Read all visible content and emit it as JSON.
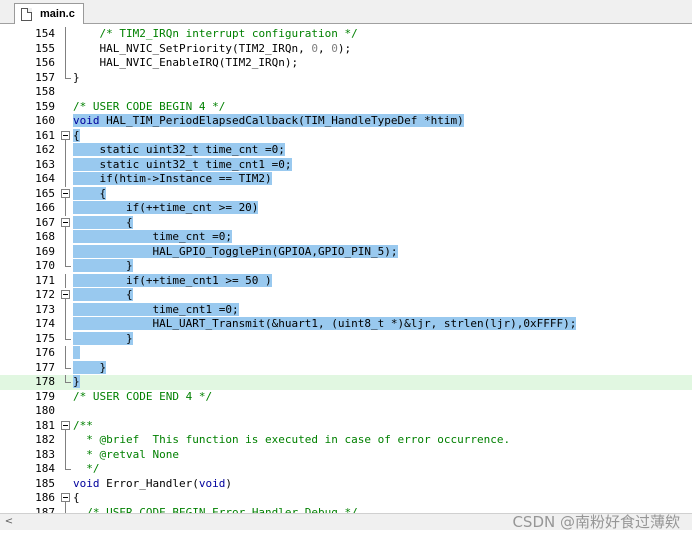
{
  "tab": {
    "label": "main.c",
    "icon": "file-icon"
  },
  "editor": {
    "current_line": "178",
    "lines": [
      {
        "n": "154",
        "fold": "line",
        "seg": [
          [
            "    ",
            ""
          ],
          [
            "/* TIM2_IRQn interrupt configuration */",
            "cm"
          ]
        ]
      },
      {
        "n": "155",
        "fold": "line",
        "seg": [
          [
            "    HAL_NVIC_SetPriority(TIM2_IRQn, ",
            ""
          ],
          [
            "0",
            "num"
          ],
          [
            ", ",
            ""
          ],
          [
            "0",
            "num"
          ],
          [
            ");",
            ""
          ]
        ]
      },
      {
        "n": "156",
        "fold": "line",
        "seg": [
          [
            "    HAL_NVIC_EnableIRQ(TIM2_IRQn);",
            ""
          ]
        ]
      },
      {
        "n": "157",
        "fold": "end",
        "seg": [
          [
            "}",
            ""
          ]
        ]
      },
      {
        "n": "158",
        "fold": "",
        "seg": []
      },
      {
        "n": "159",
        "fold": "",
        "seg": [
          [
            "/* USER CODE BEGIN 4 */",
            "cm"
          ]
        ]
      },
      {
        "n": "160",
        "fold": "",
        "sel": true,
        "seg": [
          [
            "void",
            "kw"
          ],
          [
            " HAL_TIM_PeriodElapsedCallback(TIM_HandleTypeDef *htim)",
            ""
          ]
        ]
      },
      {
        "n": "161",
        "fold": "box",
        "sel": true,
        "seg": [
          [
            "{",
            ""
          ]
        ]
      },
      {
        "n": "162",
        "fold": "line",
        "sel": true,
        "seg": [
          [
            "    static uint32_t time_cnt =0;",
            ""
          ]
        ]
      },
      {
        "n": "163",
        "fold": "line",
        "sel": true,
        "seg": [
          [
            "    static uint32_t time_cnt1 =0;",
            ""
          ]
        ]
      },
      {
        "n": "164",
        "fold": "line",
        "sel": true,
        "seg": [
          [
            "    if(htim->Instance == TIM2)",
            ""
          ]
        ]
      },
      {
        "n": "165",
        "fold": "box",
        "sel": true,
        "seg": [
          [
            "    {",
            ""
          ]
        ]
      },
      {
        "n": "166",
        "fold": "line",
        "sel": true,
        "seg": [
          [
            "        if(++time_cnt >= 20)",
            ""
          ]
        ]
      },
      {
        "n": "167",
        "fold": "box",
        "sel": true,
        "seg": [
          [
            "        {",
            ""
          ]
        ]
      },
      {
        "n": "168",
        "fold": "line",
        "sel": true,
        "seg": [
          [
            "            time_cnt =0;",
            ""
          ]
        ]
      },
      {
        "n": "169",
        "fold": "line",
        "sel": true,
        "seg": [
          [
            "            HAL_GPIO_TogglePin(GPIOA,GPIO_PIN_5);",
            ""
          ]
        ]
      },
      {
        "n": "170",
        "fold": "end",
        "sel": true,
        "seg": [
          [
            "        }",
            ""
          ]
        ]
      },
      {
        "n": "171",
        "fold": "line",
        "sel": true,
        "seg": [
          [
            "        if(++time_cnt1 >= 50 )",
            ""
          ]
        ]
      },
      {
        "n": "172",
        "fold": "box",
        "sel": true,
        "seg": [
          [
            "        {",
            ""
          ]
        ]
      },
      {
        "n": "173",
        "fold": "line",
        "sel": true,
        "seg": [
          [
            "            time_cnt1 =0;",
            ""
          ]
        ]
      },
      {
        "n": "174",
        "fold": "line",
        "sel": true,
        "seg": [
          [
            "            HAL_UART_Transmit(&huart1, (uint8_t *)&ljr, strlen(ljr),0xFFFF);",
            ""
          ]
        ]
      },
      {
        "n": "175",
        "fold": "end",
        "sel": true,
        "seg": [
          [
            "        }",
            ""
          ]
        ]
      },
      {
        "n": "176",
        "fold": "line",
        "sel": true,
        "seg": [
          [
            " ",
            ""
          ]
        ]
      },
      {
        "n": "177",
        "fold": "end",
        "sel": true,
        "seg": [
          [
            "    }",
            ""
          ]
        ]
      },
      {
        "n": "178",
        "fold": "end",
        "sel": true,
        "seg": [
          [
            "}",
            ""
          ]
        ]
      },
      {
        "n": "179",
        "fold": "",
        "seg": [
          [
            "/* USER CODE END 4 */",
            "cm"
          ]
        ]
      },
      {
        "n": "180",
        "fold": "",
        "seg": []
      },
      {
        "n": "181",
        "fold": "box",
        "seg": [
          [
            "/**",
            "cm"
          ]
        ]
      },
      {
        "n": "182",
        "fold": "line",
        "seg": [
          [
            "  * @brief  This function is executed in case of error occurrence.",
            "cm"
          ]
        ]
      },
      {
        "n": "183",
        "fold": "line",
        "seg": [
          [
            "  * @retval None",
            "cm"
          ]
        ]
      },
      {
        "n": "184",
        "fold": "end",
        "seg": [
          [
            "  */",
            "cm"
          ]
        ]
      },
      {
        "n": "185",
        "fold": "",
        "seg": [
          [
            "void",
            "kw"
          ],
          [
            " Error_Handler(",
            ""
          ],
          [
            "void",
            "kw"
          ],
          [
            ")",
            ""
          ]
        ]
      },
      {
        "n": "186",
        "fold": "box",
        "seg": [
          [
            "{",
            ""
          ]
        ]
      },
      {
        "n": "187",
        "fold": "line",
        "seg": [
          [
            "  ",
            ""
          ],
          [
            "/* USER CODE BEGIN Error_Handler_Debug */",
            "cm"
          ]
        ]
      }
    ]
  },
  "scrollbar": {
    "left_arrow": "<"
  },
  "watermark": "CSDN @南粉好食过薄欸"
}
